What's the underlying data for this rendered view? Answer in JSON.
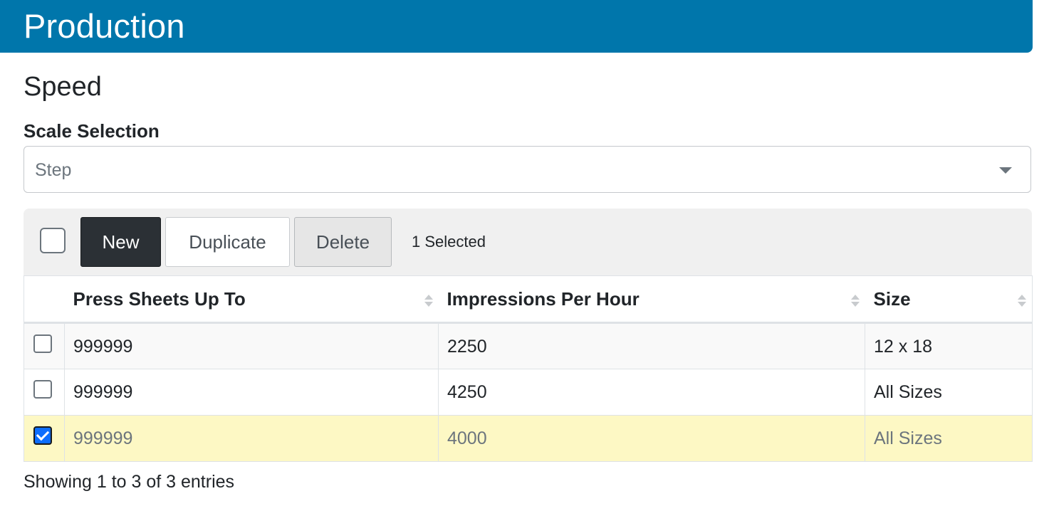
{
  "header": {
    "title": "Production"
  },
  "section": {
    "title": "Speed"
  },
  "scale": {
    "label": "Scale Selection",
    "value": "Step"
  },
  "toolbar": {
    "new_label": "New",
    "duplicate_label": "Duplicate",
    "delete_label": "Delete",
    "selected_text": "1 Selected"
  },
  "table": {
    "columns": [
      "Press Sheets Up To",
      "Impressions Per Hour",
      "Size"
    ],
    "rows": [
      {
        "press_sheets": "999999",
        "impressions": "2250",
        "size": "12 x 18",
        "checked": false
      },
      {
        "press_sheets": "999999",
        "impressions": "4250",
        "size": "All Sizes",
        "checked": false
      },
      {
        "press_sheets": "999999",
        "impressions": "4000",
        "size": "All Sizes",
        "checked": true
      }
    ]
  },
  "footer": {
    "info": "Showing 1 to 3 of 3 entries"
  },
  "icons": [
    "chevron-down-icon",
    "sort-icon",
    "checkbox-icon"
  ],
  "colors": {
    "header_bg": "#0076ab",
    "selected_row": "#fdf8c4",
    "primary_button": "#2b3035"
  }
}
